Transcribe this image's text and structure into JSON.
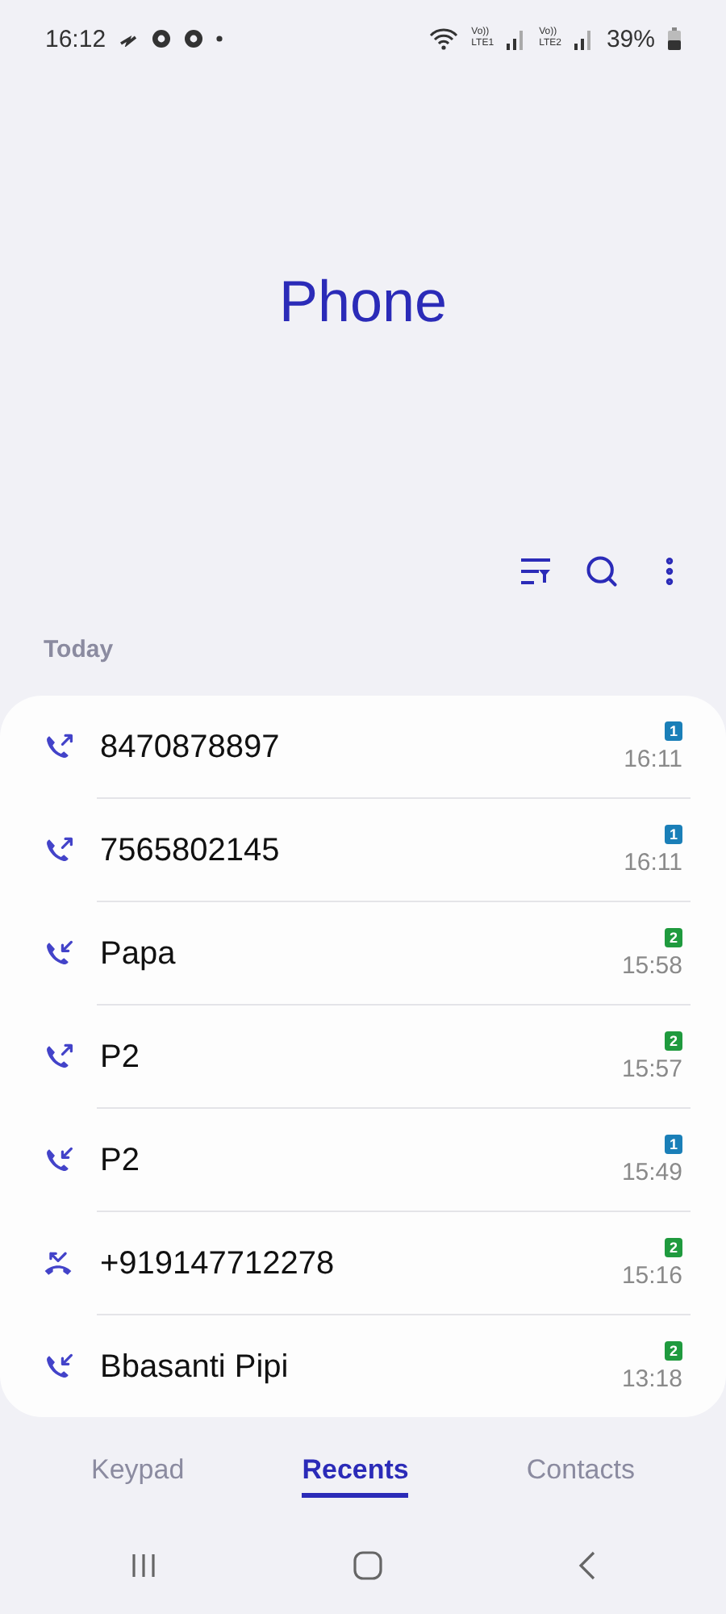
{
  "status_bar": {
    "time": "16:12",
    "sims": [
      {
        "top": "Vo))",
        "bottom": "LTE1"
      },
      {
        "top": "Vo))",
        "bottom": "LTE2"
      }
    ],
    "battery": "39%"
  },
  "title": "Phone",
  "section": "Today",
  "calls": [
    {
      "name": "8470878897",
      "kind": "outgoing",
      "sim": "1",
      "color": "#1a7fb8",
      "time": "16:11"
    },
    {
      "name": "7565802145",
      "kind": "outgoing",
      "sim": "1",
      "color": "#1a7fb8",
      "time": "16:11"
    },
    {
      "name": "Papa",
      "kind": "incoming",
      "sim": "2",
      "color": "#1f9a3e",
      "time": "15:58"
    },
    {
      "name": "P2",
      "kind": "outgoing",
      "sim": "2",
      "color": "#1f9a3e",
      "time": "15:57"
    },
    {
      "name": "P2",
      "kind": "incoming",
      "sim": "1",
      "color": "#1a7fb8",
      "time": "15:49"
    },
    {
      "name": "+919147712278",
      "kind": "rejected",
      "sim": "2",
      "color": "#1f9a3e",
      "time": "15:16"
    },
    {
      "name": "Bbasanti Pipi",
      "kind": "incoming",
      "sim": "2",
      "color": "#1f9a3e",
      "time": "13:18"
    }
  ],
  "tabs": [
    {
      "label": "Keypad",
      "selected": false
    },
    {
      "label": "Recents",
      "selected": true
    },
    {
      "label": "Contacts",
      "selected": false
    }
  ]
}
